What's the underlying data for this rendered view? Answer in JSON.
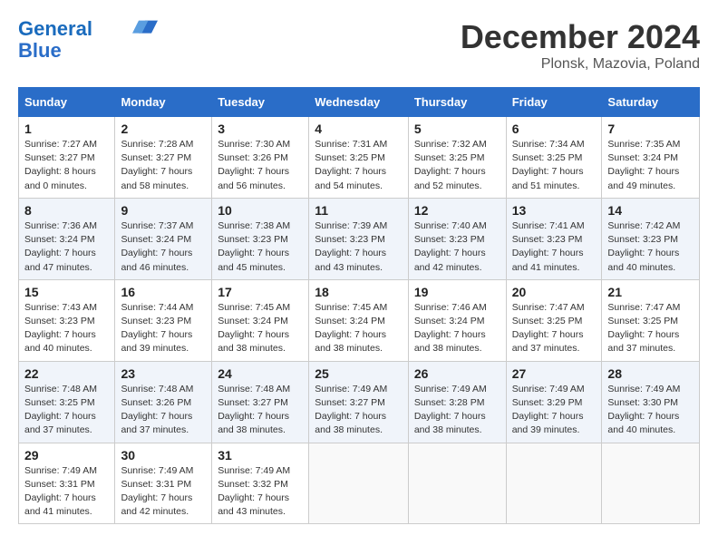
{
  "logo": {
    "line1": "General",
    "line2": "Blue"
  },
  "title": "December 2024",
  "location": "Plonsk, Mazovia, Poland",
  "weekdays": [
    "Sunday",
    "Monday",
    "Tuesday",
    "Wednesday",
    "Thursday",
    "Friday",
    "Saturday"
  ],
  "weeks": [
    [
      {
        "day": "1",
        "sunrise": "Sunrise: 7:27 AM",
        "sunset": "Sunset: 3:27 PM",
        "daylight": "Daylight: 8 hours and 0 minutes."
      },
      {
        "day": "2",
        "sunrise": "Sunrise: 7:28 AM",
        "sunset": "Sunset: 3:27 PM",
        "daylight": "Daylight: 7 hours and 58 minutes."
      },
      {
        "day": "3",
        "sunrise": "Sunrise: 7:30 AM",
        "sunset": "Sunset: 3:26 PM",
        "daylight": "Daylight: 7 hours and 56 minutes."
      },
      {
        "day": "4",
        "sunrise": "Sunrise: 7:31 AM",
        "sunset": "Sunset: 3:25 PM",
        "daylight": "Daylight: 7 hours and 54 minutes."
      },
      {
        "day": "5",
        "sunrise": "Sunrise: 7:32 AM",
        "sunset": "Sunset: 3:25 PM",
        "daylight": "Daylight: 7 hours and 52 minutes."
      },
      {
        "day": "6",
        "sunrise": "Sunrise: 7:34 AM",
        "sunset": "Sunset: 3:25 PM",
        "daylight": "Daylight: 7 hours and 51 minutes."
      },
      {
        "day": "7",
        "sunrise": "Sunrise: 7:35 AM",
        "sunset": "Sunset: 3:24 PM",
        "daylight": "Daylight: 7 hours and 49 minutes."
      }
    ],
    [
      {
        "day": "8",
        "sunrise": "Sunrise: 7:36 AM",
        "sunset": "Sunset: 3:24 PM",
        "daylight": "Daylight: 7 hours and 47 minutes."
      },
      {
        "day": "9",
        "sunrise": "Sunrise: 7:37 AM",
        "sunset": "Sunset: 3:24 PM",
        "daylight": "Daylight: 7 hours and 46 minutes."
      },
      {
        "day": "10",
        "sunrise": "Sunrise: 7:38 AM",
        "sunset": "Sunset: 3:23 PM",
        "daylight": "Daylight: 7 hours and 45 minutes."
      },
      {
        "day": "11",
        "sunrise": "Sunrise: 7:39 AM",
        "sunset": "Sunset: 3:23 PM",
        "daylight": "Daylight: 7 hours and 43 minutes."
      },
      {
        "day": "12",
        "sunrise": "Sunrise: 7:40 AM",
        "sunset": "Sunset: 3:23 PM",
        "daylight": "Daylight: 7 hours and 42 minutes."
      },
      {
        "day": "13",
        "sunrise": "Sunrise: 7:41 AM",
        "sunset": "Sunset: 3:23 PM",
        "daylight": "Daylight: 7 hours and 41 minutes."
      },
      {
        "day": "14",
        "sunrise": "Sunrise: 7:42 AM",
        "sunset": "Sunset: 3:23 PM",
        "daylight": "Daylight: 7 hours and 40 minutes."
      }
    ],
    [
      {
        "day": "15",
        "sunrise": "Sunrise: 7:43 AM",
        "sunset": "Sunset: 3:23 PM",
        "daylight": "Daylight: 7 hours and 40 minutes."
      },
      {
        "day": "16",
        "sunrise": "Sunrise: 7:44 AM",
        "sunset": "Sunset: 3:23 PM",
        "daylight": "Daylight: 7 hours and 39 minutes."
      },
      {
        "day": "17",
        "sunrise": "Sunrise: 7:45 AM",
        "sunset": "Sunset: 3:24 PM",
        "daylight": "Daylight: 7 hours and 38 minutes."
      },
      {
        "day": "18",
        "sunrise": "Sunrise: 7:45 AM",
        "sunset": "Sunset: 3:24 PM",
        "daylight": "Daylight: 7 hours and 38 minutes."
      },
      {
        "day": "19",
        "sunrise": "Sunrise: 7:46 AM",
        "sunset": "Sunset: 3:24 PM",
        "daylight": "Daylight: 7 hours and 38 minutes."
      },
      {
        "day": "20",
        "sunrise": "Sunrise: 7:47 AM",
        "sunset": "Sunset: 3:25 PM",
        "daylight": "Daylight: 7 hours and 37 minutes."
      },
      {
        "day": "21",
        "sunrise": "Sunrise: 7:47 AM",
        "sunset": "Sunset: 3:25 PM",
        "daylight": "Daylight: 7 hours and 37 minutes."
      }
    ],
    [
      {
        "day": "22",
        "sunrise": "Sunrise: 7:48 AM",
        "sunset": "Sunset: 3:25 PM",
        "daylight": "Daylight: 7 hours and 37 minutes."
      },
      {
        "day": "23",
        "sunrise": "Sunrise: 7:48 AM",
        "sunset": "Sunset: 3:26 PM",
        "daylight": "Daylight: 7 hours and 37 minutes."
      },
      {
        "day": "24",
        "sunrise": "Sunrise: 7:48 AM",
        "sunset": "Sunset: 3:27 PM",
        "daylight": "Daylight: 7 hours and 38 minutes."
      },
      {
        "day": "25",
        "sunrise": "Sunrise: 7:49 AM",
        "sunset": "Sunset: 3:27 PM",
        "daylight": "Daylight: 7 hours and 38 minutes."
      },
      {
        "day": "26",
        "sunrise": "Sunrise: 7:49 AM",
        "sunset": "Sunset: 3:28 PM",
        "daylight": "Daylight: 7 hours and 38 minutes."
      },
      {
        "day": "27",
        "sunrise": "Sunrise: 7:49 AM",
        "sunset": "Sunset: 3:29 PM",
        "daylight": "Daylight: 7 hours and 39 minutes."
      },
      {
        "day": "28",
        "sunrise": "Sunrise: 7:49 AM",
        "sunset": "Sunset: 3:30 PM",
        "daylight": "Daylight: 7 hours and 40 minutes."
      }
    ],
    [
      {
        "day": "29",
        "sunrise": "Sunrise: 7:49 AM",
        "sunset": "Sunset: 3:31 PM",
        "daylight": "Daylight: 7 hours and 41 minutes."
      },
      {
        "day": "30",
        "sunrise": "Sunrise: 7:49 AM",
        "sunset": "Sunset: 3:31 PM",
        "daylight": "Daylight: 7 hours and 42 minutes."
      },
      {
        "day": "31",
        "sunrise": "Sunrise: 7:49 AM",
        "sunset": "Sunset: 3:32 PM",
        "daylight": "Daylight: 7 hours and 43 minutes."
      },
      null,
      null,
      null,
      null
    ]
  ]
}
